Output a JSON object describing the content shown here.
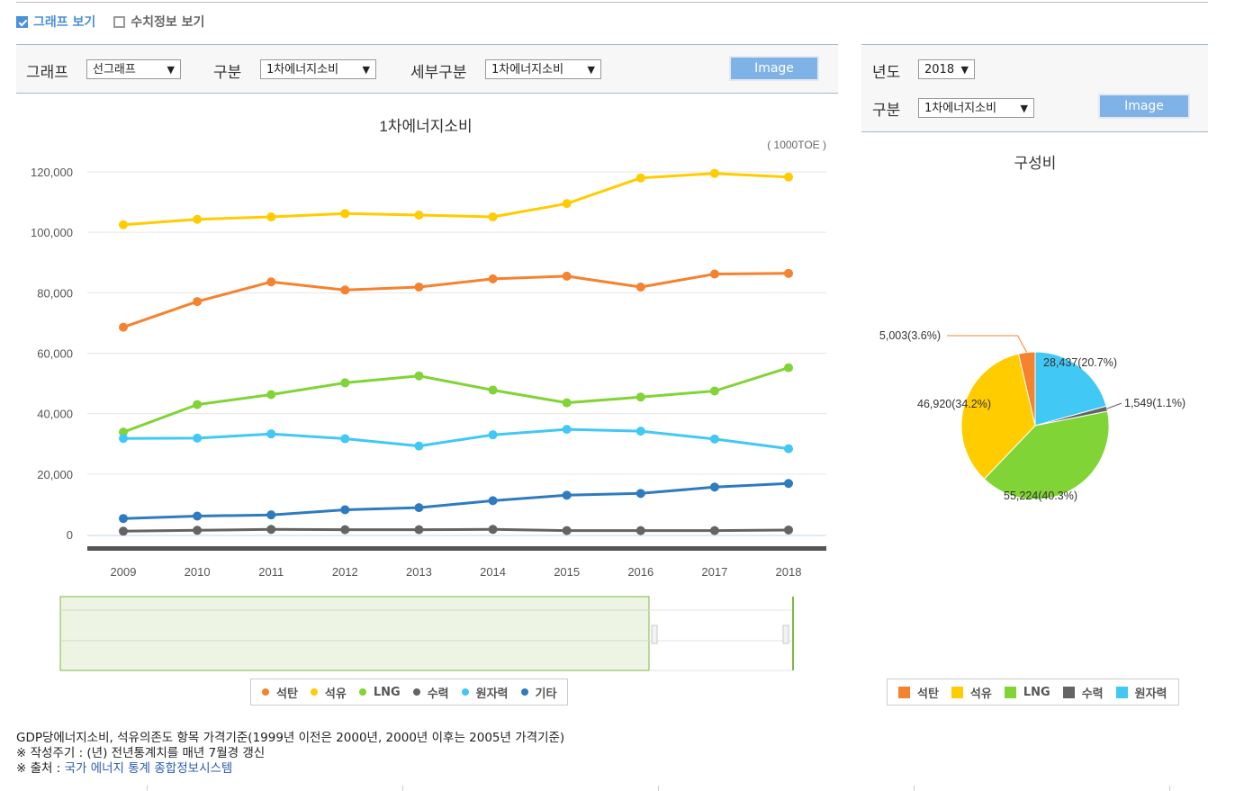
{
  "checks": {
    "graph": "그래프 보기",
    "numeric": "수치정보 보기"
  },
  "left_panel": {
    "graph_label": "그래프",
    "graph_value": "선그래프",
    "cat_label": "구분",
    "cat_value": "1차에너지소비",
    "sub_label": "세부구분",
    "sub_value": "1차에너지소비",
    "image_btn": "Image"
  },
  "right_panel": {
    "year_label": "년도",
    "year_value": "2018",
    "cat_label": "구분",
    "cat_value": "1차에너지소비",
    "image_btn": "Image"
  },
  "colors": {
    "coal": "#f5822f",
    "oil": "#ffcc00",
    "lng": "#80d435",
    "hydro": "#646464",
    "nuclear": "#42c8f5",
    "other": "#2f7bbf"
  },
  "chart_data": [
    {
      "type": "line",
      "title": "1차에너지소비",
      "unit": "( 1000TOE )",
      "x": [
        "2009",
        "2010",
        "2011",
        "2012",
        "2013",
        "2014",
        "2015",
        "2016",
        "2017",
        "2018"
      ],
      "ylim": [
        0,
        120000
      ],
      "yticks": [
        "0",
        "20,000",
        "40,000",
        "60,000",
        "80,000",
        "100,000",
        "120,000"
      ],
      "grid": true,
      "legend_position": "bottom",
      "series": [
        {
          "name": "석탄",
          "key": "coal",
          "values": [
            68600,
            77100,
            83600,
            80900,
            81900,
            84600,
            85500,
            81900,
            86200,
            86400
          ]
        },
        {
          "name": "석유",
          "key": "oil",
          "values": [
            102500,
            104300,
            105100,
            106200,
            105700,
            105100,
            109500,
            118000,
            119500,
            118300
          ]
        },
        {
          "name": "LNG",
          "key": "lng",
          "values": [
            33900,
            43000,
            46300,
            50200,
            52500,
            47800,
            43600,
            45500,
            47500,
            55200
          ]
        },
        {
          "name": "수력",
          "key": "hydro",
          "values": [
            1100,
            1400,
            1700,
            1600,
            1600,
            1700,
            1300,
            1300,
            1300,
            1500
          ]
        },
        {
          "name": "원자력",
          "key": "nuclear",
          "values": [
            31800,
            31900,
            33300,
            31700,
            29300,
            33000,
            34800,
            34200,
            31600,
            28400
          ]
        },
        {
          "name": "기타",
          "key": "other",
          "values": [
            5300,
            6100,
            6500,
            8200,
            8900,
            11200,
            13000,
            13600,
            15700,
            16900
          ]
        }
      ]
    },
    {
      "type": "pie",
      "title": "구성비",
      "legend_position": "bottom",
      "slices": [
        {
          "name": "석탄",
          "key": "coal",
          "value": 5003,
          "label": "5,003(3.6%)"
        },
        {
          "name": "원자력",
          "key": "nuclear",
          "value": 28437,
          "label": "28,437(20.7%)"
        },
        {
          "name": "수력",
          "key": "hydro",
          "value": 1549,
          "label": "1,549(1.1%)"
        },
        {
          "name": "LNG",
          "key": "lng",
          "value": 55224,
          "label": "55,224(40.3%)"
        },
        {
          "name": "석유",
          "key": "oil",
          "value": 46920,
          "label": "46,920(34.2%)"
        }
      ]
    }
  ],
  "line_legend": [
    "석탄",
    "석유",
    "LNG",
    "수력",
    "원자력",
    "기타"
  ],
  "pie_legend": [
    "석탄",
    "석유",
    "LNG",
    "수력",
    "원자력"
  ],
  "footer": {
    "line1": "GDP당에너지소비, 석유의존도 항목 가격기준(1999년 이전은 2000년, 2000년 이후는 2005년 가격기준)",
    "line2": "※ 작성주기 : (년) 전년통계치를 매년 7월경 갱신",
    "line3_prefix": "※ 출처 : ",
    "line3_link": "국가 에너지 통계 종합정보시스템"
  }
}
